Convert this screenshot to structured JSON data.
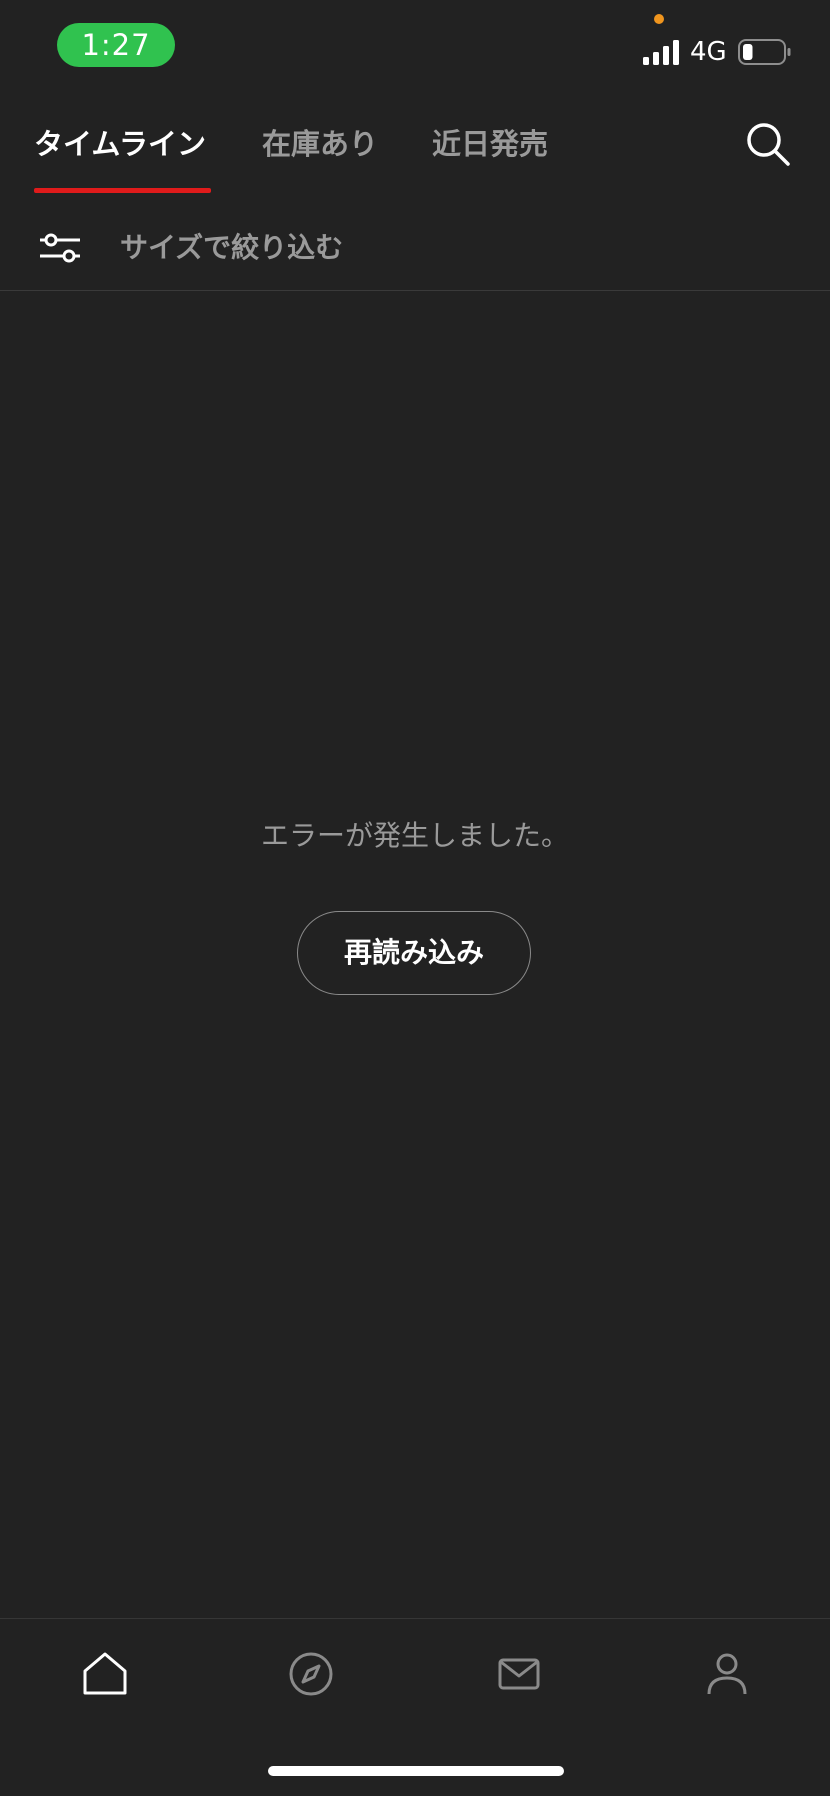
{
  "status_bar": {
    "time": "1:27",
    "network": "4G",
    "signal_bars": 4,
    "battery_level": 0.25,
    "time_pill_color": "#30c24f",
    "privacy_dot_color": "#f0951e"
  },
  "tabs": [
    {
      "label": "タイムライン",
      "active": true
    },
    {
      "label": "在庫あり",
      "active": false
    },
    {
      "label": "近日発売",
      "active": false
    }
  ],
  "accent_color": "#e01b1b",
  "filter": {
    "label": "サイズで絞り込む",
    "icon": "sliders-icon"
  },
  "error": {
    "message": "エラーが発生しました。",
    "reload_label": "再読み込み"
  },
  "bottom_nav": [
    {
      "icon": "home-icon",
      "active": true
    },
    {
      "icon": "compass-icon",
      "active": false
    },
    {
      "icon": "mail-icon",
      "active": false
    },
    {
      "icon": "user-icon",
      "active": false
    }
  ]
}
